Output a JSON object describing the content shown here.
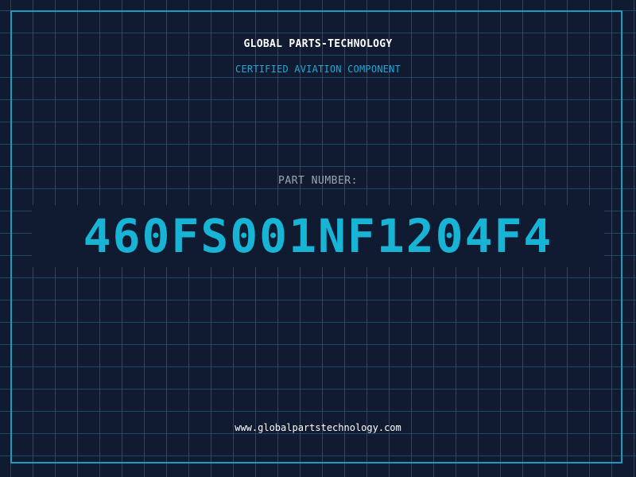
{
  "header": {
    "company": "GLOBAL PARTS-TECHNOLOGY",
    "subtitle": "CERTIFIED AVIATION COMPONENT"
  },
  "part": {
    "label": "PART NUMBER:",
    "number": "460FS001NF1204F4"
  },
  "footer": {
    "url": "www.globalpartstechnology.com"
  },
  "colors": {
    "background": "#101a30",
    "grid": "#1c4a63",
    "accent": "#17b4d6",
    "frame": "#1a9cc2",
    "label": "#9aa6b6"
  }
}
